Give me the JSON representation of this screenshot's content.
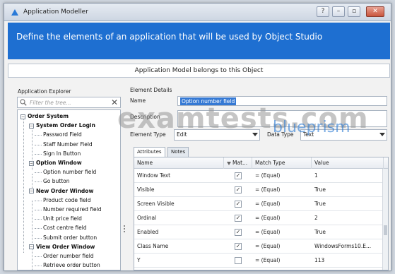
{
  "window": {
    "title": "Application Modeller",
    "controls": {
      "help": "?",
      "minimize": "–",
      "maximize": "▫",
      "close": "✕"
    }
  },
  "banner": {
    "text": "Define the elements of an application that will be used by Object Studio"
  },
  "band": {
    "text": "Application Model belongs to this Object"
  },
  "explorer": {
    "label": "Application Explorer",
    "filter_placeholder": "Filter the tree...",
    "clear": "✕",
    "tree": [
      {
        "label": "Order System",
        "level": 0,
        "group": true
      },
      {
        "label": "System Order Login",
        "level": 1,
        "group": true
      },
      {
        "label": "Password Field",
        "level": 2
      },
      {
        "label": "Staff Number Field",
        "level": 2
      },
      {
        "label": "Sign In Button",
        "level": 2
      },
      {
        "label": "Option Window",
        "level": 1,
        "group": true
      },
      {
        "label": "Option number field",
        "level": 2
      },
      {
        "label": "Go button",
        "level": 2
      },
      {
        "label": "New Order Window",
        "level": 1,
        "group": true
      },
      {
        "label": "Product code field",
        "level": 2
      },
      {
        "label": "Number required field",
        "level": 2
      },
      {
        "label": "Unit price field",
        "level": 2
      },
      {
        "label": "Cost centre field",
        "level": 2
      },
      {
        "label": "Submit order button",
        "level": 2
      },
      {
        "label": "View Order Window",
        "level": 1,
        "group": true
      },
      {
        "label": "Order number field",
        "level": 2
      },
      {
        "label": "Retrieve order button",
        "level": 2
      }
    ]
  },
  "details": {
    "heading": "Element Details",
    "name_label": "Name",
    "name_value": "Option number field",
    "description_label": "Description",
    "description_value": "",
    "type_label": "Element Type",
    "type_value": "Edit",
    "datatype_label": "Data Type",
    "datatype_value": "Text"
  },
  "tabs": [
    "Attributes",
    "Notes"
  ],
  "grid": {
    "headers": [
      "Name",
      "Mat...",
      "Match Type",
      "Value"
    ],
    "rows": [
      {
        "name": "Window Text",
        "match": true,
        "match_type": "= (Equal)",
        "value": "1"
      },
      {
        "name": "Visible",
        "match": true,
        "match_type": "= (Equal)",
        "value": "True"
      },
      {
        "name": "Screen Visible",
        "match": true,
        "match_type": "= (Equal)",
        "value": "True"
      },
      {
        "name": "Ordinal",
        "match": true,
        "match_type": "= (Equal)",
        "value": "2"
      },
      {
        "name": "Enabled",
        "match": true,
        "match_type": "= (Equal)",
        "value": "True"
      },
      {
        "name": "Class Name",
        "match": true,
        "match_type": "= (Equal)",
        "value": "WindowsForms10.E..."
      },
      {
        "name": "Y",
        "match": false,
        "match_type": "= (Equal)",
        "value": "113"
      }
    ]
  },
  "watermarks": {
    "site": "examtests.com",
    "brand": "blueprism"
  },
  "colors": {
    "banner": "#1e6fd1",
    "selection": "#3579d4"
  }
}
